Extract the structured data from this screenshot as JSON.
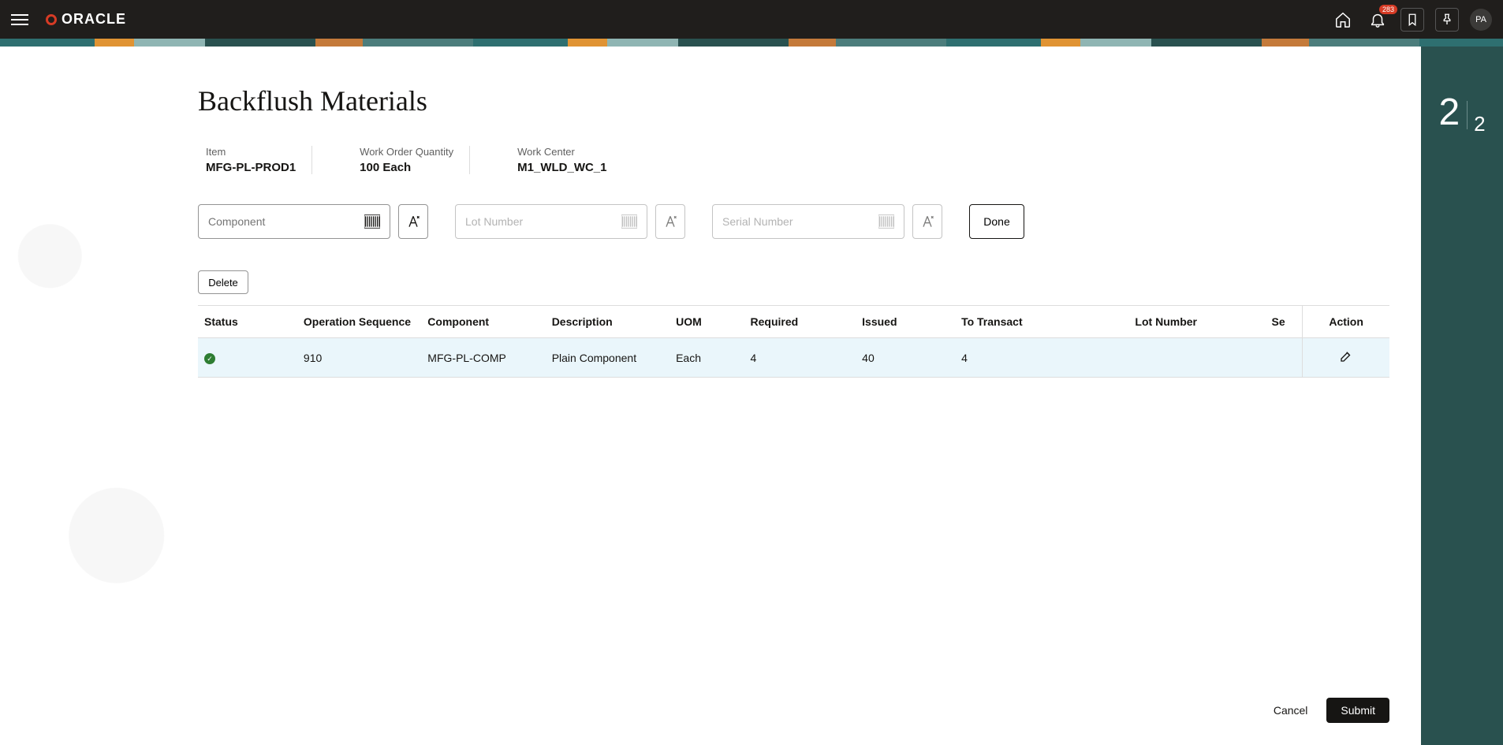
{
  "topbar": {
    "logo_text": "ORACLE",
    "notification_count": "283",
    "avatar_initials": "PA"
  },
  "step": {
    "current": "2",
    "total": "2"
  },
  "page_title": "Backflush Materials",
  "header_info": {
    "item_label": "Item",
    "item_value": "MFG-PL-PROD1",
    "qty_label": "Work Order Quantity",
    "qty_value": "100 Each",
    "wc_label": "Work Center",
    "wc_value": "M1_WLD_WC_1"
  },
  "scan": {
    "component_placeholder": "Component",
    "lot_placeholder": "Lot Number",
    "serial_placeholder": "Serial Number",
    "done_label": "Done"
  },
  "buttons": {
    "delete": "Delete",
    "cancel": "Cancel",
    "submit": "Submit"
  },
  "table": {
    "columns": {
      "status": "Status",
      "op_seq": "Operation Sequence",
      "component": "Component",
      "description": "Description",
      "uom": "UOM",
      "required": "Required",
      "issued": "Issued",
      "to_transact": "To Transact",
      "lot_number": "Lot Number",
      "serial": "Se",
      "action": "Action"
    },
    "rows": [
      {
        "status": "ok",
        "op_seq": "910",
        "component": "MFG-PL-COMP",
        "description": "Plain Component",
        "uom": "Each",
        "required": "4",
        "issued": "40",
        "to_transact": "4",
        "lot_number": "",
        "serial": ""
      }
    ]
  }
}
